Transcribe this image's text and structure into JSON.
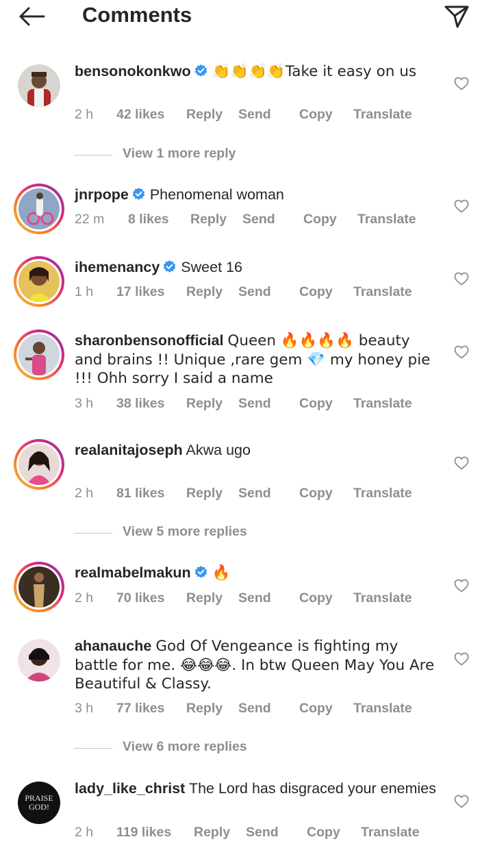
{
  "header": {
    "title": "Comments",
    "back_icon": "arrow-left-icon",
    "send_icon": "paper-plane-icon"
  },
  "actions": {
    "reply": "Reply",
    "send": "Send",
    "copy": "Copy",
    "translate": "Translate"
  },
  "colors": {
    "text": "#262626",
    "muted": "#8e8e8e",
    "verified": "#3897f0",
    "ring_start": "#f9c13c",
    "ring_end": "#8134af"
  },
  "comments": [
    {
      "username": "bensonokonkwo",
      "verified": true,
      "text": "👏👏👏👏Take it easy on us",
      "time": "2 h",
      "likes": "42 likes",
      "story_ring": false,
      "view_more": "View 1 more reply"
    },
    {
      "username": "jnrpope",
      "verified": true,
      "text": "Phenomenal woman",
      "time": "22 m",
      "likes": "8 likes",
      "story_ring": true,
      "view_more": ""
    },
    {
      "username": "ihemenancy",
      "verified": true,
      "text": "Sweet 16",
      "time": "1 h",
      "likes": "17 likes",
      "story_ring": true,
      "view_more": ""
    },
    {
      "username": "sharonbensonofficial",
      "verified": false,
      "text": "Queen 🔥🔥🔥🔥 beauty and brains !! Unique ,rare gem 💎 my honey pie !!! Ohh sorry I said a name",
      "time": "3 h",
      "likes": "38 likes",
      "story_ring": true,
      "view_more": ""
    },
    {
      "username": "realanitajoseph",
      "verified": false,
      "text": "Akwa ugo",
      "time": "2 h",
      "likes": "81 likes",
      "story_ring": true,
      "view_more": "View 5 more replies"
    },
    {
      "username": "realmabelmakun",
      "verified": true,
      "text": "🔥",
      "time": "2 h",
      "likes": "70 likes",
      "story_ring": true,
      "view_more": ""
    },
    {
      "username": "ahanauche",
      "verified": false,
      "text": "God Of Vengeance is fighting my battle for me. 😂😂😂. In btw Queen May You Are Beautiful & Classy.",
      "time": "3 h",
      "likes": "77 likes",
      "story_ring": false,
      "view_more": "View 6 more replies"
    },
    {
      "username": "lady_like_christ",
      "verified": false,
      "text": "The Lord has disgraced your enemies",
      "time": "2 h",
      "likes": "119 likes",
      "story_ring": false,
      "view_more": "",
      "avatar_text": "PRAISE GOD!"
    }
  ]
}
